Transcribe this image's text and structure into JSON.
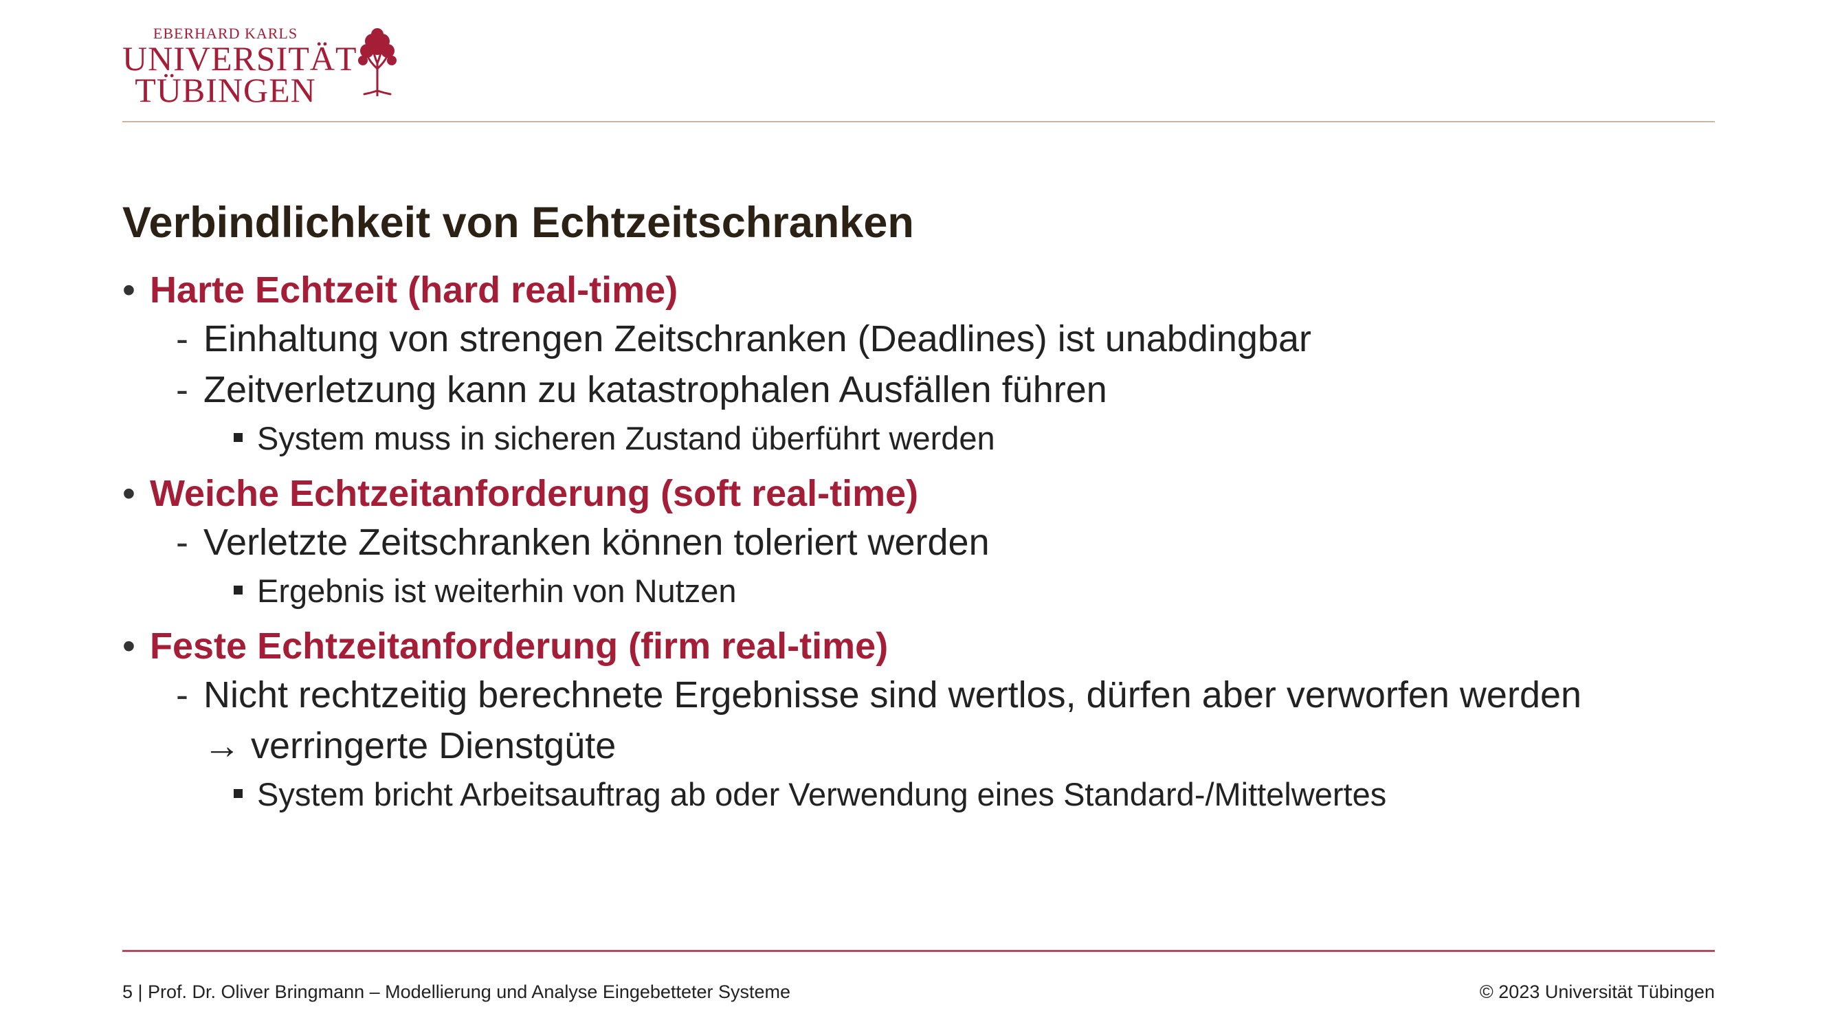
{
  "header": {
    "logo_line1": "EBERHARD KARLS",
    "logo_line2": "UNIVERSITÄT",
    "logo_line3": "TÜBINGEN"
  },
  "slide": {
    "title": "Verbindlichkeit von Echtzeitschranken",
    "sections": [
      {
        "heading": "Harte Echtzeit (hard real-time)",
        "items": [
          "Einhaltung von strengen Zeitschranken (Deadlines) ist unabdingbar",
          "Zeitverletzung kann zu katastrophalen Ausfällen führen"
        ],
        "subitems": [
          "System muss in sicheren Zustand überführt werden"
        ]
      },
      {
        "heading": "Weiche Echtzeitanforderung (soft real-time)",
        "items": [
          "Verletzte Zeitschranken können toleriert werden"
        ],
        "subitems": [
          "Ergebnis ist weiterhin von Nutzen"
        ]
      },
      {
        "heading": "Feste Echtzeitanforderung (firm real-time)",
        "items": [
          "Nicht rechtzeitig berechnete Ergebnisse sind wertlos, dürfen aber verworfen werden"
        ],
        "continuation": "→ verringerte Dienstgüte",
        "subitems": [
          "System bricht Arbeitsauftrag ab oder Verwendung eines Standard-/Mittelwertes"
        ]
      }
    ]
  },
  "markers": {
    "level1": "•",
    "level2": "-"
  },
  "footer": {
    "left": "5 | Prof. Dr. Oliver Bringmann – Modellierung und Analyse Eingebetteter Systeme",
    "right": "© 2023 Universität Tübingen"
  },
  "colors": {
    "accent": "#a51e37",
    "title": "#2b2115",
    "rule_top": "#c9b6a0",
    "rule_bottom": "#b04c66"
  },
  "icons": {
    "logo": "university-tree-logo-icon",
    "arrow": "right-arrow-icon"
  }
}
